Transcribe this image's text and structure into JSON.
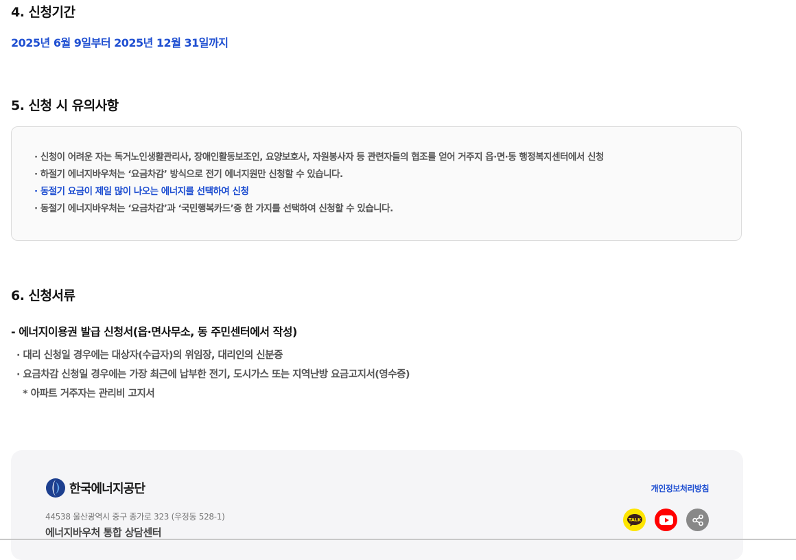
{
  "sections": {
    "period": {
      "title": "4. 신청기간",
      "text": "2025년 6월 9일부터 2025년 12월 31일까지"
    },
    "notice": {
      "title": "5. 신청 시 유의사항",
      "items": [
        "· 신청이 어려운 자는 독거노인생활관리사, 장애인활동보조인, 요양보호사, 자원봉사자 등 관련자들의 협조를 얻어 거주지 읍·면·동 행정복지센터에서 신청",
        "· 하절기 에너지바우처는 ‘요금차감’ 방식으로 전기 에너지원만 신청할 수 있습니다.",
        "· 동절기 요금이 제일 많이 나오는 에너지를 선택하여 신청",
        "· 동절기 에너지바우처는 ‘요금차감’과 ‘국민행복카드’중 한 가지를 선택하여 신청할 수 있습니다."
      ]
    },
    "documents": {
      "title": "6. 신청서류",
      "subtitle": "- 에너지이용권 발급 신청서(읍·면사무소, 동 주민센터에서 작성)",
      "items": [
        "· 대리 신청일 경우에는 대상자(수급자)의 위임장, 대리인의 신분증",
        "· 요금차감 신청일 경우에는 가장 최근에 납부한 전기, 도시가스 또는 지역난방 요금고지서(영수증)",
        "* 아파트 거주자는 관리비 고지서"
      ]
    }
  },
  "footer": {
    "logo_text": "한국에너지공단",
    "address": "44538 울산광역시 중구 종가로 323 (우정동 528-1)",
    "center": "에너지바우처 통합 상담센터",
    "privacy": "개인정보처리방침",
    "kakao_label": "TALK",
    "social_icons": [
      "kakao-talk-icon",
      "youtube-icon",
      "share-icon"
    ]
  },
  "colors": {
    "accent": "#1f4fd1",
    "kakao": "#fee500",
    "youtube": "#ff0000",
    "share": "#888888"
  }
}
